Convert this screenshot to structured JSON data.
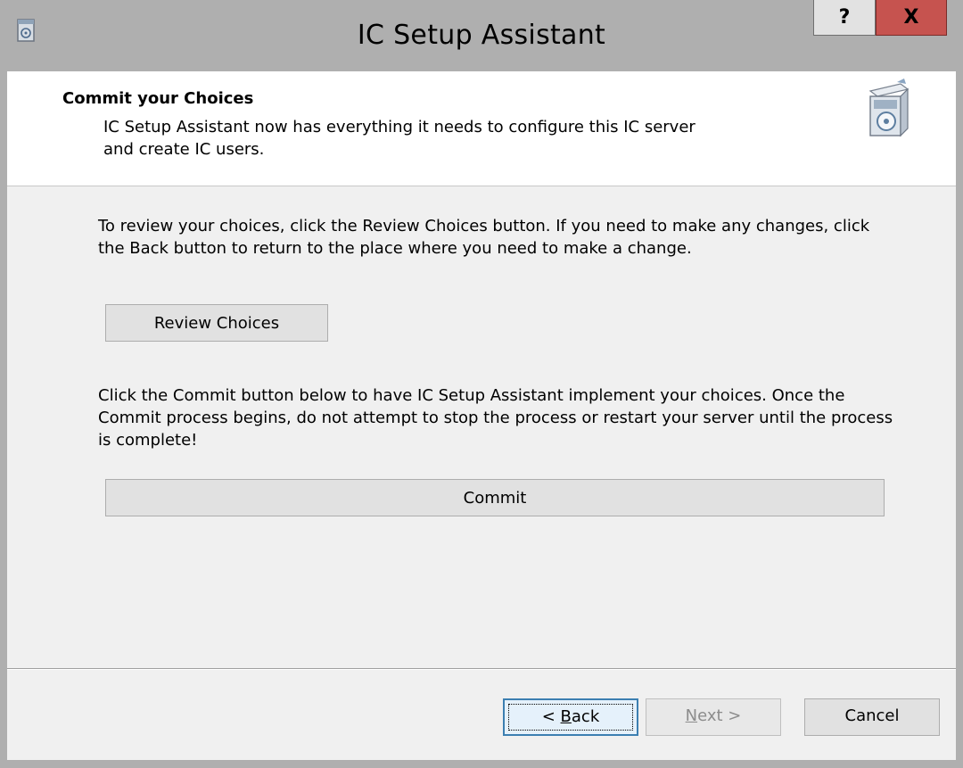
{
  "window": {
    "title": "IC Setup Assistant",
    "help_label": "?",
    "close_label": "X",
    "app_icon": "setup-assistant-icon"
  },
  "header": {
    "title": "Commit your Choices",
    "description": "IC Setup Assistant now has everything it needs to configure this IC server and create IC users.",
    "icon": "software-box-icon"
  },
  "content": {
    "review_text": "To review your choices, click the Review Choices button. If you need to make any changes, click the Back button to return to the place where you need to make a change.",
    "review_button": "Review Choices",
    "commit_text": "Click the Commit button below to have IC Setup Assistant implement your choices. Once the Commit process begins, do not attempt to stop the process or restart your server until the process is complete!",
    "commit_button": "Commit"
  },
  "footer": {
    "back_prefix": "< ",
    "back_mnemonic": "B",
    "back_rest": "ack",
    "next_mnemonic": "N",
    "next_rest": "ext >",
    "cancel_label": "Cancel"
  },
  "colors": {
    "title_bar": "#afafaf",
    "close_button": "#c6534f",
    "dialog_body": "#f0f0f0",
    "focus_border": "#3c7fb1"
  }
}
